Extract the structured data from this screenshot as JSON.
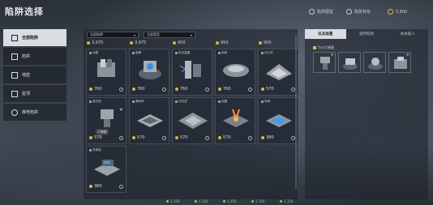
{
  "title": "陷阱选择",
  "top_stats": [
    {
      "icon": "crest-icon",
      "label": "陷阱图鉴"
    },
    {
      "icon": "crest-icon",
      "label": "陷阱背包"
    },
    {
      "icon": "gold-icon",
      "label": "5,800"
    }
  ],
  "sidebar": {
    "items": [
      {
        "label": "全部陷阱",
        "icon": "trap-all-icon",
        "active": true
      },
      {
        "label": "陷阱",
        "icon": "trap-icon"
      },
      {
        "label": "墙壁",
        "icon": "wall-icon"
      },
      {
        "label": "屋顶",
        "icon": "roof-icon"
      },
      {
        "label": "推荐陷阱",
        "icon": "recommend-icon"
      }
    ]
  },
  "filters": {
    "left": "全部陷阱",
    "right": "全部类型"
  },
  "price_row": [
    "3,975",
    "3,975",
    "950",
    "950",
    "950"
  ],
  "cards": [
    {
      "name": "冰霜",
      "cost": "760"
    },
    {
      "name": "磁暴",
      "cost": "760"
    },
    {
      "name": "电击装置",
      "cost": "760"
    },
    {
      "name": "地刺",
      "cost": "760"
    },
    {
      "name": "动力斧",
      "cost": "570"
    },
    {
      "name": "激光炮",
      "cost": "570",
      "tag": "已装配"
    },
    {
      "name": "毒刺阵",
      "cost": "570"
    },
    {
      "name": "冲击波",
      "cost": "570"
    },
    {
      "name": "地雷",
      "cost": "570"
    },
    {
      "name": "电网",
      "cost": "380"
    },
    {
      "name": "导弹炮",
      "cost": "380"
    }
  ],
  "right_panel": {
    "tabs": [
      "队友装置",
      "通用陷阱",
      "本关敌人"
    ],
    "active_tab": 0,
    "slot_label": "为火力装备",
    "slots": [
      "slot-1",
      "slot-2",
      "slot-3",
      "slot-4"
    ]
  },
  "bottom_resources": [
    "1,150",
    "1,150",
    "1,150",
    "1,150",
    "1,150"
  ],
  "colors": {
    "gold": "#d8b840",
    "active_tab": "#d9dde1",
    "panel": "#1c2129"
  }
}
